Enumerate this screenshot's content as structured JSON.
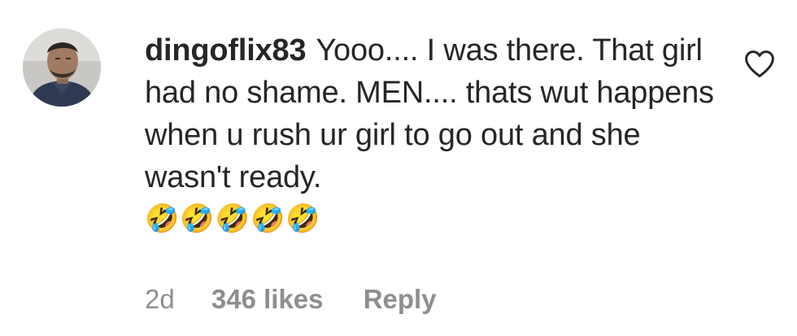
{
  "comment": {
    "username": "dingoflix83",
    "text": "Yooo.... I was there. That girl had no shame. MEN.... thats wut happens when u rush ur girl to go out and she wasn't ready.",
    "emojis": "🤣🤣🤣🤣🤣",
    "time": "2d",
    "likes": "346 likes",
    "reply_label": "Reply"
  },
  "icons": {
    "like": "heart-outline-icon",
    "avatar": "profile-photo"
  },
  "colors": {
    "text": "#262626",
    "meta": "#8e8e8e"
  }
}
